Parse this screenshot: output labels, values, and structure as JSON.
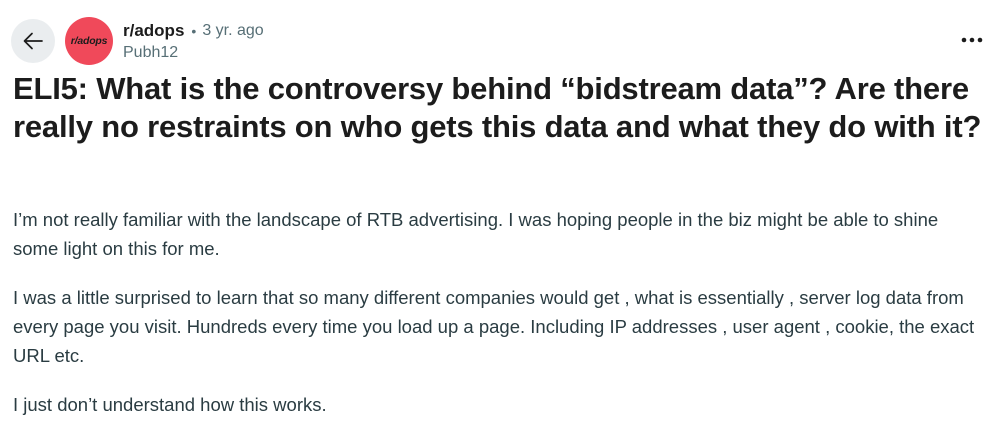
{
  "header": {
    "back_icon": "arrow-left-icon",
    "avatar_text": "r/adops",
    "subreddit": "r/adops",
    "separator": "•",
    "time_ago": "3 yr. ago",
    "author": "Pubh12",
    "more_icon": "more-horizontal-icon"
  },
  "post": {
    "title": "ELI5: What is the controversy behind “bidstream data”? Are there really no restraints on who gets this data and what they do with it?",
    "paragraphs": [
      "I’m not really familiar with the landscape of RTB advertising. I was hoping people in the biz might be able to shine some light on this for me.",
      "I was a little surprised to learn that so many different companies would get , what is essentially , server log data from every page you visit. Hundreds every time you load up a page. Including IP addresses , user agent , cookie, the exact URL etc.",
      "I just don’t understand how this works."
    ]
  },
  "colors": {
    "avatar_bg": "#f0495a",
    "back_button_bg": "#eaedef",
    "text_primary": "#1c1c1c",
    "text_secondary": "#576f76",
    "body_text": "#2a3c42"
  }
}
